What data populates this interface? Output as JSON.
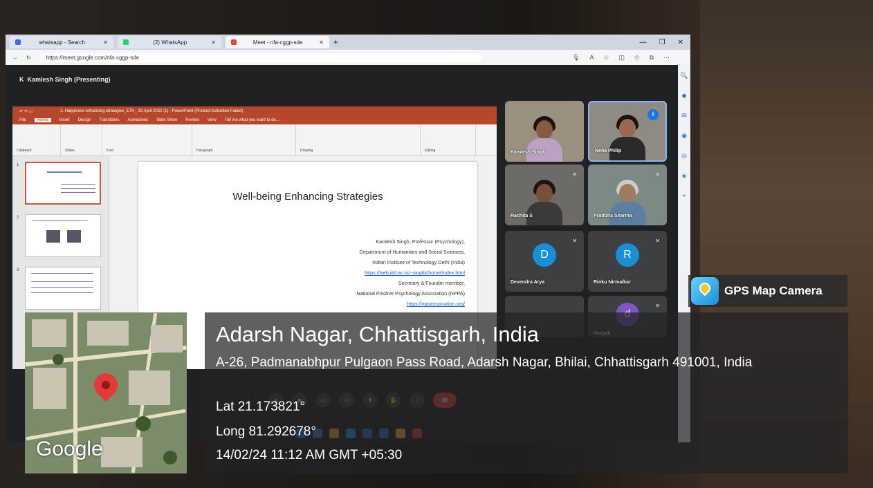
{
  "browser": {
    "tabs": [
      {
        "label": "whatsapp - Search"
      },
      {
        "label": "(2) WhatsApp"
      },
      {
        "label": "Meet - nfa-cggp-sde"
      }
    ],
    "url": "https://meet.google.com/nfa-cggp-sde"
  },
  "meet": {
    "presenting_label": "Kamlesh Singh (Presenting)",
    "participants": [
      {
        "name": "Kamlesh Singh",
        "type": "video"
      },
      {
        "name": "Neha Philip",
        "type": "video",
        "speaking": true
      },
      {
        "name": "Rachita S",
        "type": "video",
        "muted": true
      },
      {
        "name": "Pratibha Sharma",
        "type": "video",
        "muted": true
      },
      {
        "name": "Devendra Arya",
        "type": "avatar",
        "initial": "D",
        "color": "#1a8fd6",
        "muted": true
      },
      {
        "name": "Rinku Nirmalkar",
        "type": "avatar",
        "initial": "R",
        "color": "#1a8fd6",
        "muted": true
      },
      {
        "name": "deepak",
        "type": "avatar",
        "initial": "d",
        "color": "#7e57c2",
        "muted": true
      }
    ]
  },
  "powerpoint": {
    "title_bar": "2. Happiness enhancing strategies_ETH_ 20 April 2022 (1) - PowerPoint (Product Activation Failed)",
    "tabs": [
      "File",
      "Home",
      "Insert",
      "Design",
      "Transitions",
      "Animations",
      "Slide Show",
      "Review",
      "View"
    ],
    "search_hint": "Tell me what you want to do...",
    "ribbon_groups": [
      "Clipboard",
      "Slides",
      "Font",
      "Paragraph",
      "Drawing",
      "Editing"
    ],
    "slide": {
      "title": "Well-being Enhancing Strategies",
      "lines": [
        {
          "text": "Kamlesh Singh, Professor (Psychology),",
          "link": false
        },
        {
          "text": "Department of Humanities and Social Sciences,",
          "link": false
        },
        {
          "text": "Indian Institute of Technology Delhi (India)",
          "link": false
        },
        {
          "text": "https://web.iitd.ac.in/~singhk/home/index.html",
          "link": true
        },
        {
          "text": "Secretary & Founder member,",
          "link": false
        },
        {
          "text": "National Positive Psychology Association (NPPA)",
          "link": true
        },
        {
          "text": "https://nppassociation.org/",
          "link": true
        }
      ]
    }
  },
  "gps": {
    "app_name": "GPS Map Camera",
    "map_brand": "Google",
    "location_title": "Adarsh Nagar, Chhattisgarh, India",
    "address": "A-26, Padmanabhpur Pulgaon Pass Road, Adarsh Nagar, Bhilai, Chhattisgarh 491001, India",
    "lat": "Lat 21.173821°",
    "long": "Long 81.292678°",
    "datetime": "14/02/24 11:12 AM GMT +05:30"
  },
  "colors": {
    "accent": "#8ab4f8",
    "ppt": "#b7472a",
    "pin": "#e53935",
    "end_call": "#ea4335"
  }
}
